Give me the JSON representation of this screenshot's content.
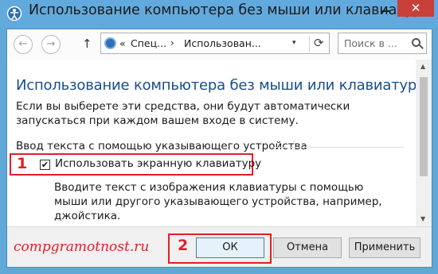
{
  "window": {
    "title": "Использование компьютера без мыши или клавиатуры",
    "close_glyph": "✕"
  },
  "nav": {
    "back_icon": "arrow-left-icon",
    "forward_icon": "arrow-right-icon",
    "up_icon": "arrow-up-icon",
    "breadcrumb_prefix": "«",
    "breadcrumb_1": "Спец...",
    "breadcrumb_sep": "›",
    "breadcrumb_2": "Использован...",
    "dropdown_glyph": "▾",
    "refresh_glyph": "⟳",
    "search_placeholder": "Поиск в ..."
  },
  "content": {
    "heading": "Использование компьютера без мыши или клавиатуры",
    "description": "Если вы выберете эти средства, они будут автоматически запускаться при каждом вашем входе в систему.",
    "section_label": "Ввод текста с помощью указывающего устройства",
    "annotation_1": "1",
    "checkbox_mark": "✔",
    "checkbox_label": "Использовать экранную клавиатуру",
    "checkbox_checked": true,
    "checkbox_desc": "Вводите текст с изображения клавиатуры с помощью мыши или другого указывающего устройства, например, джойстика."
  },
  "footer": {
    "watermark": "compgramotnost.ru",
    "annotation_2": "2",
    "ok_label": "ОК",
    "cancel_label": "Отмена",
    "apply_label": "Применить"
  },
  "colors": {
    "title_bar": "#62aade",
    "heading": "#1a4d8a",
    "annotation": "#e11e2a",
    "close_button": "#c7403a"
  }
}
